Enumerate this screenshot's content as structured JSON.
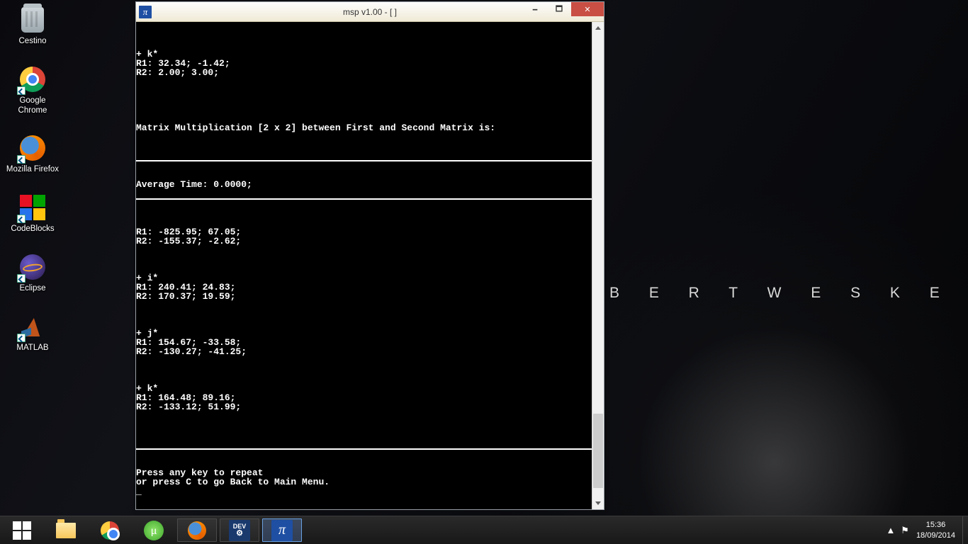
{
  "wallpaper": {
    "text_fragment": "B  E  R  T     W  E  S  K  E  R"
  },
  "desktop_icons": [
    {
      "name": "trash",
      "label": "Cestino"
    },
    {
      "name": "chrome",
      "label": "Google Chrome"
    },
    {
      "name": "firefox",
      "label": "Mozilla Firefox"
    },
    {
      "name": "codeblocks",
      "label": "CodeBlocks"
    },
    {
      "name": "eclipse",
      "label": "Eclipse"
    },
    {
      "name": "matlab",
      "label": "MATLAB"
    }
  ],
  "window": {
    "title": "msp v1.00 - [  ]",
    "icon_glyph": "π",
    "console_lines": [
      "",
      "",
      "",
      "+ k*",
      "R1: 32.34; -1.42;",
      "R2: 2.00; 3.00;",
      "",
      "",
      "",
      "",
      "",
      "Matrix Multiplication [2 x 2] between First and Second Matrix is:",
      "",
      "",
      "",
      "__RULE__",
      "",
      "",
      "Average Time: 0.0000;",
      "",
      "__RULE__",
      "",
      "",
      "",
      "R1: -825.95; 67.05;",
      "R2: -155.37; -2.62;",
      "",
      "",
      "",
      "+ i*",
      "R1: 240.41; 24.83;",
      "R2: 170.37; 19.59;",
      "",
      "",
      "",
      "+ j*",
      "R1: 154.67; -33.58;",
      "R2: -130.27; -41.25;",
      "",
      "",
      "",
      "+ k*",
      "R1: 164.48; 89.16;",
      "R2: -133.12; 51.99;",
      "",
      "",
      "",
      "",
      "__RULE__",
      "",
      "",
      "Press any key to repeat",
      "or press C to go Back to Main Menu.",
      "_"
    ],
    "scrollbar": {
      "thumb_top_pct": 82,
      "thumb_height_pct": 16
    }
  },
  "taskbar": {
    "items": [
      {
        "name": "start",
        "state": ""
      },
      {
        "name": "explorer",
        "state": ""
      },
      {
        "name": "chrome",
        "state": ""
      },
      {
        "name": "utorrent",
        "state": ""
      },
      {
        "name": "firefox",
        "state": "running"
      },
      {
        "name": "devcpp",
        "state": "running"
      },
      {
        "name": "msp",
        "state": "active"
      }
    ],
    "tray": {
      "show_hidden_glyph": "▲",
      "flag_glyph": "⚑",
      "time": "15:36",
      "date": "18/09/2014"
    }
  }
}
